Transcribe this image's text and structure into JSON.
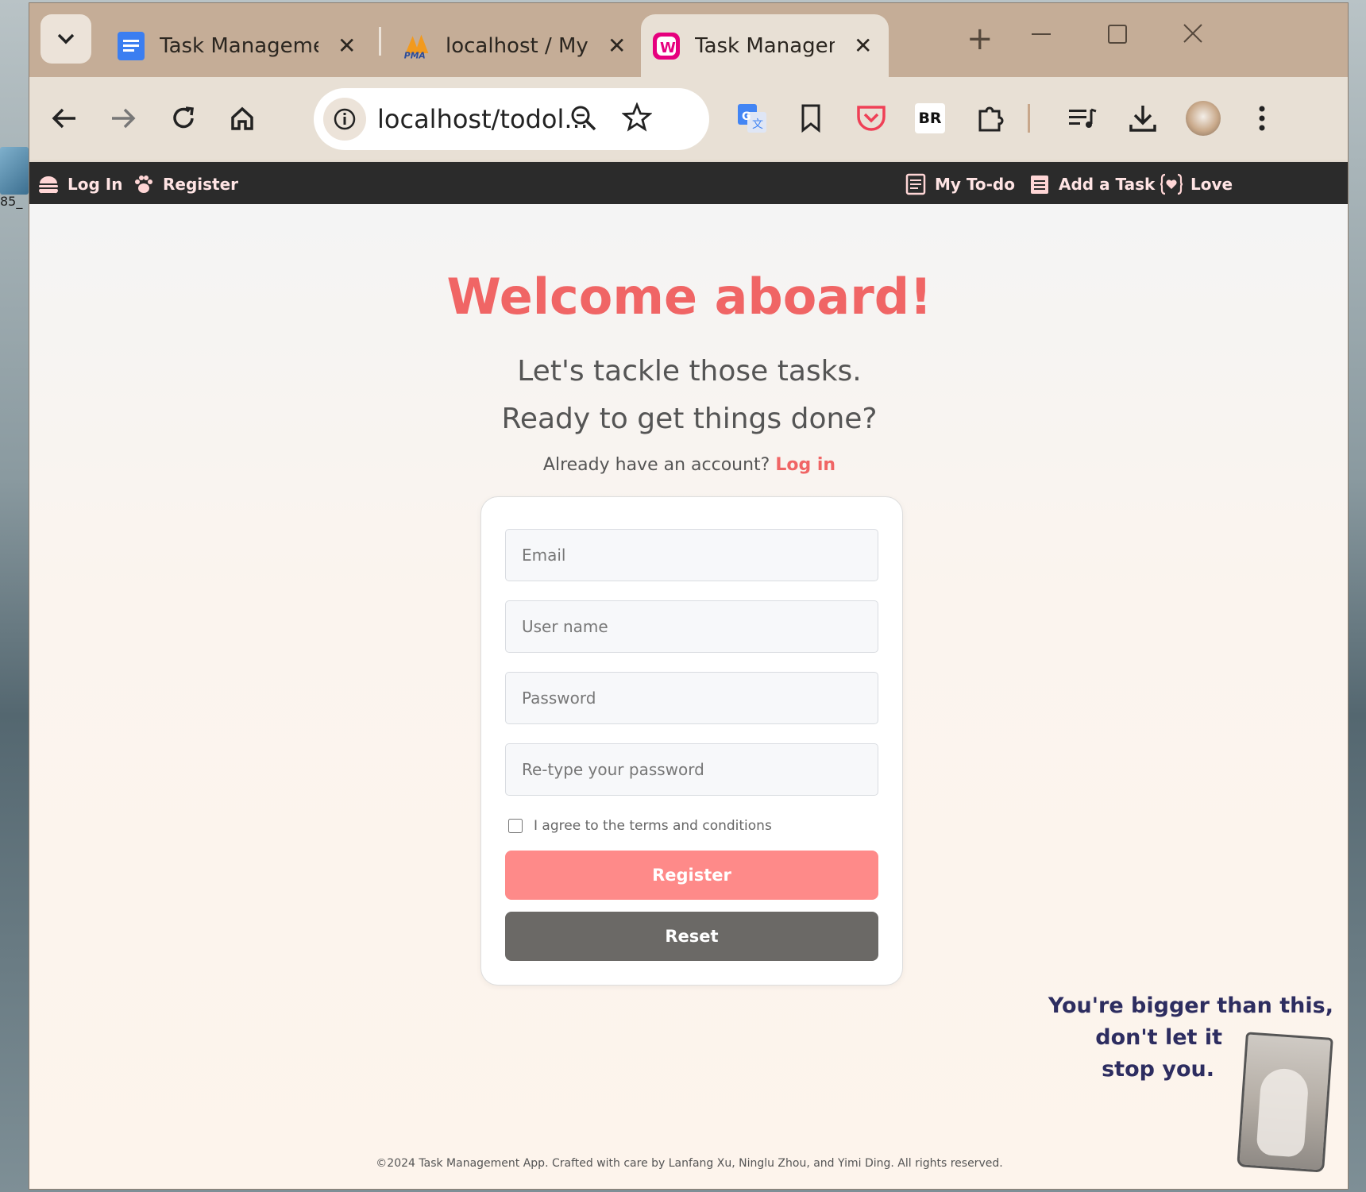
{
  "desktop": {
    "icon_label": "85_"
  },
  "browser": {
    "tabs": [
      {
        "title": "Task Management",
        "icon": "docs-icon"
      },
      {
        "title": "localhost / MySQL",
        "icon": "phpmyadmin-icon"
      },
      {
        "title": "Task Managemen",
        "icon": "wampserver-icon",
        "active": true
      }
    ],
    "new_tab_glyph": "+",
    "url": "localhost/todol...",
    "extensions": [
      "translate-icon",
      "bookmark-icon",
      "pocket-icon",
      "br-icon",
      "extensions-icon",
      "media-icon",
      "download-icon",
      "profile-avatar",
      "menu-icon"
    ],
    "br_label": "BR"
  },
  "nav": {
    "login": "Log In",
    "register": "Register",
    "my_todo": "My To-do",
    "add_task": "Add a Task",
    "love": "Love"
  },
  "main": {
    "title": "Welcome aboard!",
    "subtitle_1": "Let's tackle those tasks.",
    "subtitle_2": "Ready to get things done?",
    "already_text": "Already have an account?",
    "login_link": "Log in"
  },
  "form": {
    "email_placeholder": "Email",
    "username_placeholder": "User name",
    "password_placeholder": "Password",
    "retype_placeholder": "Re-type your password",
    "terms_label": "I agree to the terms and conditions",
    "terms_checked": false,
    "register_label": "Register",
    "reset_label": "Reset"
  },
  "quote": {
    "line1": "You're bigger than this,",
    "line2": "don't let it",
    "line3": "stop you."
  },
  "footer": "©2024 Task Management App. Crafted with care by Lanfang Xu, Ninglu Zhou, and Yimi Ding. All rights reserved.",
  "colors": {
    "accent": "#f06565",
    "register_button": "#fe8a89",
    "reset_button": "#6b6966",
    "nav_bg": "#2b2b2b",
    "tabstrip_bg": "#c5ad97"
  }
}
